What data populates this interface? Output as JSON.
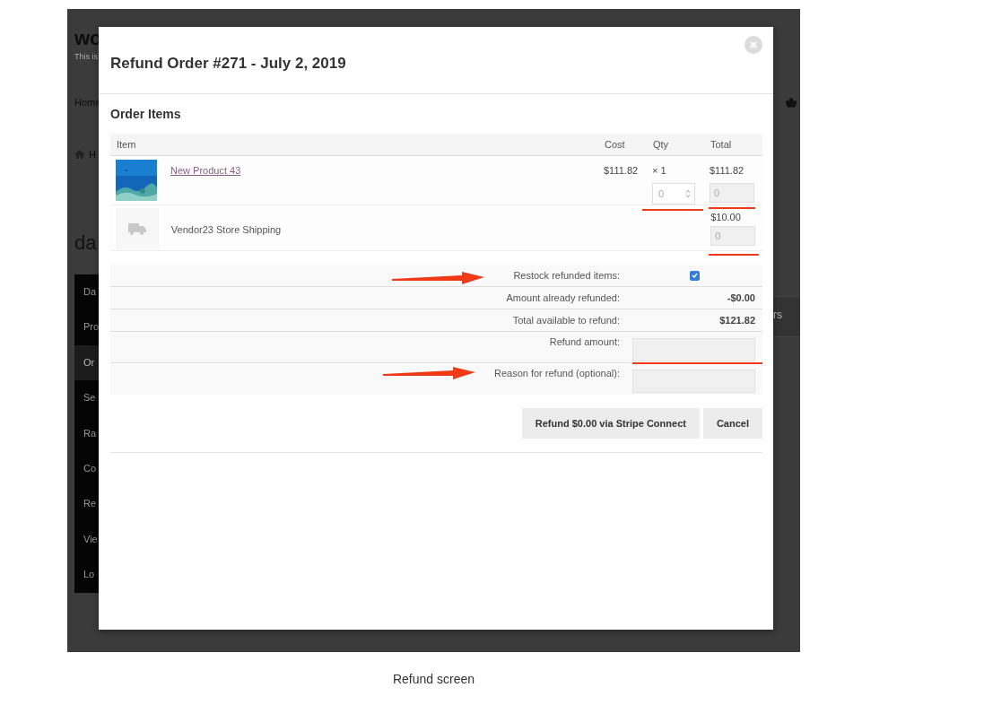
{
  "background_page": {
    "logo": "wo",
    "tagline": "This is",
    "nav_item": "Home",
    "breadcrumb": "H",
    "page_title": "da",
    "side_text": "rs",
    "sidebar": [
      {
        "label": "Da",
        "selected": false
      },
      {
        "label": "Pro",
        "selected": false
      },
      {
        "label": "Or",
        "selected": true
      },
      {
        "label": "Se",
        "selected": false
      },
      {
        "label": "Ra",
        "selected": false
      },
      {
        "label": "Co",
        "selected": false
      },
      {
        "label": "Re",
        "selected": false
      },
      {
        "label": "Vie",
        "selected": false
      },
      {
        "label": "Lo",
        "selected": false
      }
    ]
  },
  "modal": {
    "title": "Refund Order #271 - July 2, 2019",
    "section_title": "Order Items",
    "columns": [
      "Item",
      "Cost",
      "Qty",
      "Total"
    ],
    "items": [
      {
        "kind": "product",
        "name": "New Product 43",
        "cost": "$111.82",
        "qty": "× 1",
        "qty_placeholder": "0",
        "total": "$111.82",
        "total_placeholder": "0"
      },
      {
        "kind": "shipping",
        "name": "Vendor23 Store Shipping",
        "total": "$10.00",
        "total_placeholder": "0"
      }
    ],
    "summary": [
      {
        "kind": "checkbox",
        "label": "Restock refunded items:",
        "checked": true
      },
      {
        "kind": "value",
        "label": "Amount already refunded:",
        "value": "-$0.00"
      },
      {
        "kind": "value",
        "label": "Total available to refund:",
        "value": "$121.82"
      },
      {
        "kind": "input",
        "label": "Refund amount:"
      },
      {
        "kind": "input",
        "label": "Reason for refund (optional):"
      }
    ],
    "buttons": [
      "Refund $0.00 via Stripe Connect",
      "Cancel"
    ]
  },
  "caption": "Refund screen"
}
